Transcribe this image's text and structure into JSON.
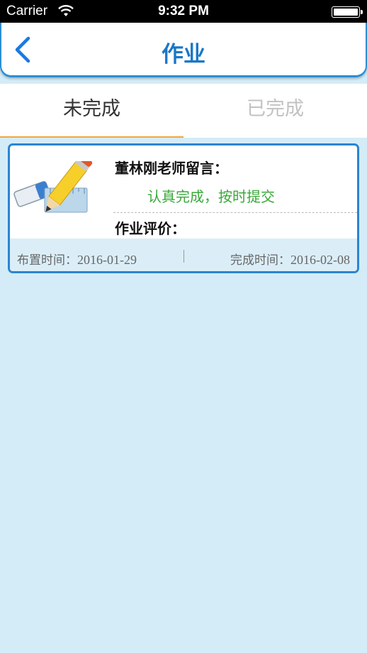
{
  "status_bar": {
    "carrier": "Carrier",
    "time": "9:32 PM"
  },
  "nav": {
    "title": "作业",
    "back_icon": "chevron-left-icon",
    "accent_color": "#1b77c6"
  },
  "tabs": [
    {
      "label": "未完成",
      "active": true
    },
    {
      "label": "已完成",
      "active": false
    }
  ],
  "homework": [
    {
      "teacher_label": "董林刚老师留言：",
      "message": "认真完成，按时提交",
      "evaluation_label": "作业评价：",
      "assign_label": "布置时间：",
      "assign_date": "2016-01-29",
      "complete_label": "完成时间：",
      "complete_date": "2016-02-08",
      "thumb_icon": "pencil-eraser-ruler-icon"
    }
  ],
  "colors": {
    "background": "#d4ecf7",
    "card_border": "#2b84d3",
    "message_green": "#3aa83a",
    "tab_underline": "#f0a640"
  }
}
